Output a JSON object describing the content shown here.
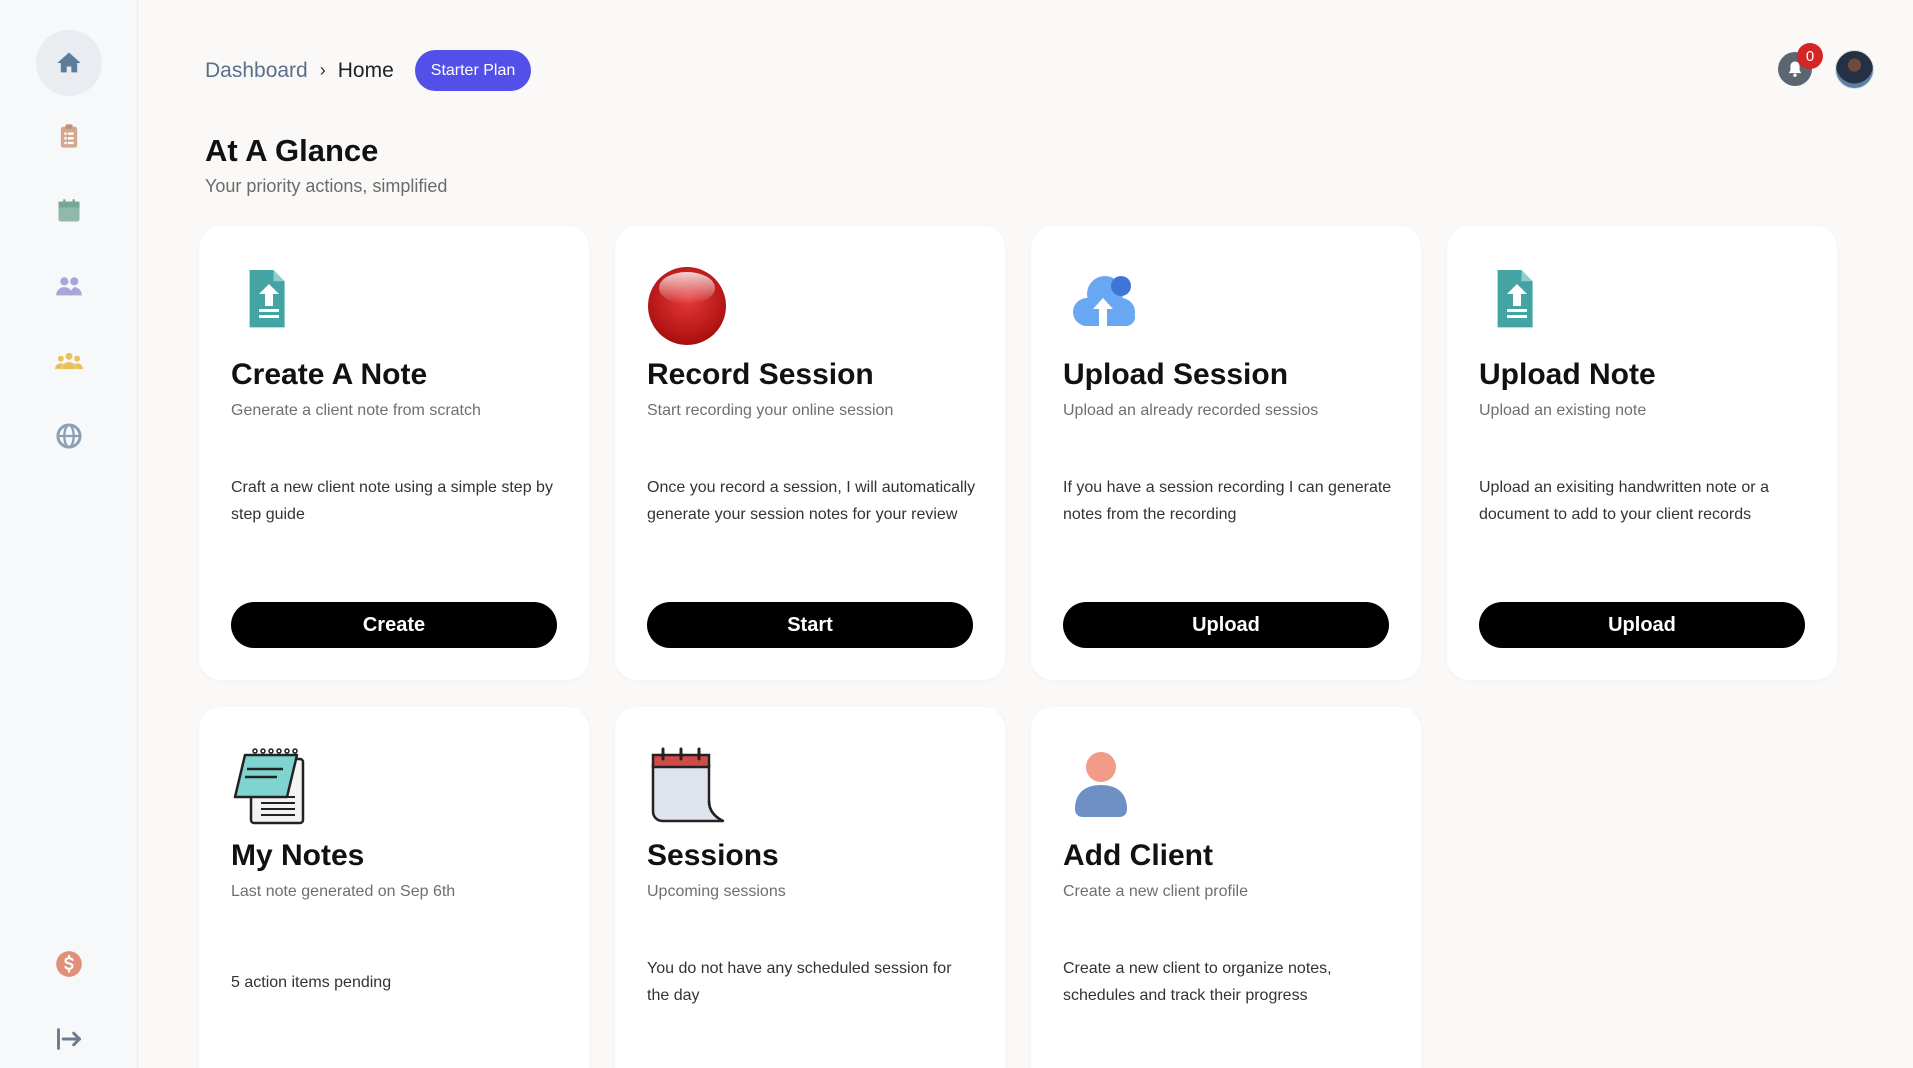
{
  "sidebar": {
    "items": [
      {
        "name": "home",
        "icon": "home-icon",
        "color": "#5b7c9a"
      },
      {
        "name": "notes",
        "icon": "clipboard-list-icon",
        "color": "#d4a78f"
      },
      {
        "name": "calendar",
        "icon": "calendar-icon",
        "color": "#8fb9a8"
      },
      {
        "name": "clients",
        "icon": "users-icon",
        "color": "#a9a6d9"
      },
      {
        "name": "groups",
        "icon": "group-icon",
        "color": "#e8c15a"
      },
      {
        "name": "web",
        "icon": "globe-icon",
        "color": "#8aa1b5"
      },
      {
        "name": "billing",
        "icon": "dollar-icon",
        "color": "#e0917a"
      },
      {
        "name": "logout",
        "icon": "logout-icon",
        "color": "#6c7a8f"
      }
    ]
  },
  "breadcrumb": {
    "parent": "Dashboard",
    "separator": "›",
    "current": "Home"
  },
  "plan_badge": "Starter Plan",
  "notifications": {
    "count": "0"
  },
  "page": {
    "title": "At A Glance",
    "subtitle": "Your priority actions, simplified"
  },
  "cards": [
    {
      "title": "Create A Note",
      "subtitle": "Generate a client note from scratch",
      "description": "Craft a new client note using a simple step by step guide",
      "button": "Create",
      "icon": "file-upload-icon"
    },
    {
      "title": "Record Session",
      "subtitle": "Start recording your online session",
      "description": "Once you record a session, I will automatically generate your session notes for your review",
      "button": "Start",
      "icon": "record-icon"
    },
    {
      "title": "Upload Session",
      "subtitle": "Upload an already recorded sessios",
      "description": "If you have a session recording I can generate notes from the recording",
      "button": "Upload",
      "icon": "cloud-upload-icon"
    },
    {
      "title": "Upload Note",
      "subtitle": "Upload an existing note",
      "description": "Upload an exisiting handwritten note or a document to add to your client records",
      "button": "Upload",
      "icon": "file-upload-icon"
    },
    {
      "title": "My Notes",
      "subtitle": "Last note generated on Sep 6th",
      "description": "5 action items pending",
      "icon": "notepad-icon"
    },
    {
      "title": "Sessions",
      "subtitle": "Upcoming sessions",
      "description": "You do not have any scheduled session for the day",
      "icon": "calendar-page-icon"
    },
    {
      "title": "Add Client",
      "subtitle": "Create a new client profile",
      "description": "Create a new client to organize notes, schedules and track their progress",
      "icon": "person-icon"
    }
  ],
  "colors": {
    "accent": "#5250e8",
    "badge": "#d32626",
    "button": "#000000"
  }
}
